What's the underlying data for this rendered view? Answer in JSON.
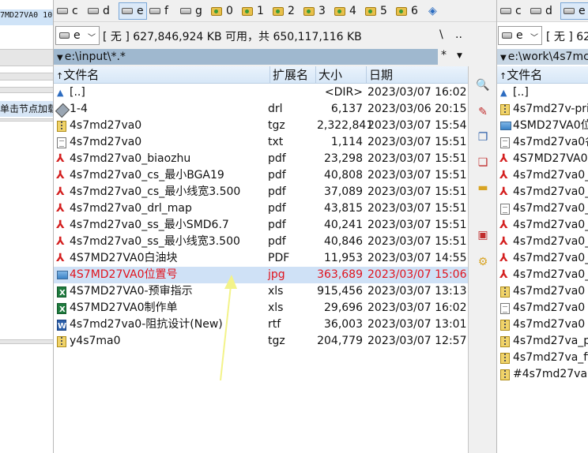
{
  "left_strip": {
    "selected_text": "7MD27VA0  10",
    "hint_text": "单击节点加载"
  },
  "left_panel": {
    "drives": [
      {
        "label": "c",
        "icon": "disk-icon"
      },
      {
        "label": "d",
        "icon": "disk-icon"
      },
      {
        "label": "e",
        "icon": "disk-icon",
        "active": true
      },
      {
        "label": "f",
        "icon": "disk-icon"
      },
      {
        "label": "g",
        "icon": "disk-icon"
      },
      {
        "label": "0",
        "icon": "folder-icon"
      },
      {
        "label": "1",
        "icon": "folder-icon"
      },
      {
        "label": "2",
        "icon": "folder-icon"
      },
      {
        "label": "3",
        "icon": "folder-icon"
      },
      {
        "label": "4",
        "icon": "folder-icon"
      },
      {
        "label": "5",
        "icon": "folder-icon"
      },
      {
        "label": "6",
        "icon": "folder-icon"
      }
    ],
    "drive_select": "e",
    "free_space": "[ 无 ]  627,846,924 KB 可用，共 650,117,116 KB",
    "root_btn": "\\",
    "parent_btn": "..",
    "path": "e:\\input\\*.*",
    "path_filter": "*",
    "columns": {
      "name": "文件名",
      "ext": "扩展名",
      "size": "大小",
      "date": "日期"
    },
    "files": [
      {
        "icon": "up-icon",
        "name": "[..]",
        "ext": "",
        "size": "<DIR>",
        "date": "2023/03/07 16:02"
      },
      {
        "icon": "drl-icon",
        "name": "1-4",
        "ext": "drl",
        "size": "6,137",
        "date": "2023/03/06 20:15"
      },
      {
        "icon": "zip-icon",
        "name": "4s7md27va0",
        "ext": "tgz",
        "size": "2,322,841",
        "date": "2023/03/07 15:54"
      },
      {
        "icon": "txt-icon",
        "name": "4s7md27va0",
        "ext": "txt",
        "size": "1,114",
        "date": "2023/03/07 15:51"
      },
      {
        "icon": "pdf-icon",
        "name": "4s7md27va0_biaozhu",
        "ext": "pdf",
        "size": "23,298",
        "date": "2023/03/07 15:51"
      },
      {
        "icon": "pdf-icon",
        "name": "4s7md27va0_cs_最小BGA19",
        "ext": "pdf",
        "size": "40,808",
        "date": "2023/03/07 15:51"
      },
      {
        "icon": "pdf-icon",
        "name": "4s7md27va0_cs_最小线宽3.500",
        "ext": "pdf",
        "size": "37,089",
        "date": "2023/03/07 15:51"
      },
      {
        "icon": "pdf-icon",
        "name": "4s7md27va0_drl_map",
        "ext": "pdf",
        "size": "43,815",
        "date": "2023/03/07 15:51"
      },
      {
        "icon": "pdf-icon",
        "name": "4s7md27va0_ss_最小SMD6.7",
        "ext": "pdf",
        "size": "40,241",
        "date": "2023/03/07 15:51"
      },
      {
        "icon": "pdf-icon",
        "name": "4s7md27va0_ss_最小线宽3.500",
        "ext": "pdf",
        "size": "40,846",
        "date": "2023/03/07 15:51"
      },
      {
        "icon": "pdf-icon",
        "name": "4S7MD27VA0白油块",
        "ext": "PDF",
        "size": "11,953",
        "date": "2023/03/07 14:55"
      },
      {
        "icon": "image-icon",
        "name": "4S7MD27VA0位置号",
        "ext": "jpg",
        "size": "363,689",
        "date": "2023/03/07 15:06",
        "selected": true
      },
      {
        "icon": "excel-icon",
        "name": "4S7MD27VA0-预审指示",
        "ext": "xls",
        "size": "915,456",
        "date": "2023/03/07 13:13"
      },
      {
        "icon": "excel-icon",
        "name": "4S7MD27VA0制作单",
        "ext": "xls",
        "size": "29,696",
        "date": "2023/03/07 16:02"
      },
      {
        "icon": "word-icon",
        "name": "4s7md27va0-阻抗设计(New)",
        "ext": "rtf",
        "size": "36,003",
        "date": "2023/03/07 13:01"
      },
      {
        "icon": "zip-icon",
        "name": "y4s7ma0",
        "ext": "tgz",
        "size": "204,779",
        "date": "2023/03/07 12:57"
      }
    ]
  },
  "right_panel": {
    "drives": [
      {
        "label": "c"
      },
      {
        "label": "d"
      },
      {
        "label": "e",
        "active": true
      }
    ],
    "drive_select": "e",
    "free_space": "[ 无 ]  62",
    "path": "e:\\work\\4s7mc",
    "name_header": "文件名",
    "files": [
      {
        "icon": "up-icon",
        "name": "[..]"
      },
      {
        "icon": "zip-icon",
        "name": "4s7md27v-prir"
      },
      {
        "icon": "image-icon",
        "name": "4SMD27VA0位"
      },
      {
        "icon": "txt-icon",
        "name": "4s7md27va0各"
      },
      {
        "icon": "pdf-icon",
        "name": "4S7MD27VA0白"
      },
      {
        "icon": "pdf-icon",
        "name": "4s7md27va0_s"
      },
      {
        "icon": "pdf-icon",
        "name": "4s7md27va0_s"
      },
      {
        "icon": "txt-icon",
        "name": "4s7md27va0_n"
      },
      {
        "icon": "pdf-icon",
        "name": "4s7md27va0_c"
      },
      {
        "icon": "pdf-icon",
        "name": "4s7md27va0_c"
      },
      {
        "icon": "pdf-icon",
        "name": "4s7md27va0_c"
      },
      {
        "icon": "pdf-icon",
        "name": "4s7md27va0_b"
      },
      {
        "icon": "zip-icon",
        "name": "4s7md27va0"
      },
      {
        "icon": "txt-icon",
        "name": "4s7md27va0"
      },
      {
        "icon": "zip-icon",
        "name": "4s7md27va0"
      },
      {
        "icon": "zip-icon",
        "name": "4s7md27va_pa"
      },
      {
        "icon": "zip-icon",
        "name": "4s7md27va_fil"
      },
      {
        "icon": "zip-icon",
        "name": "#4s7md27va0"
      }
    ]
  },
  "annotation": {
    "color": "#f3f38a"
  }
}
